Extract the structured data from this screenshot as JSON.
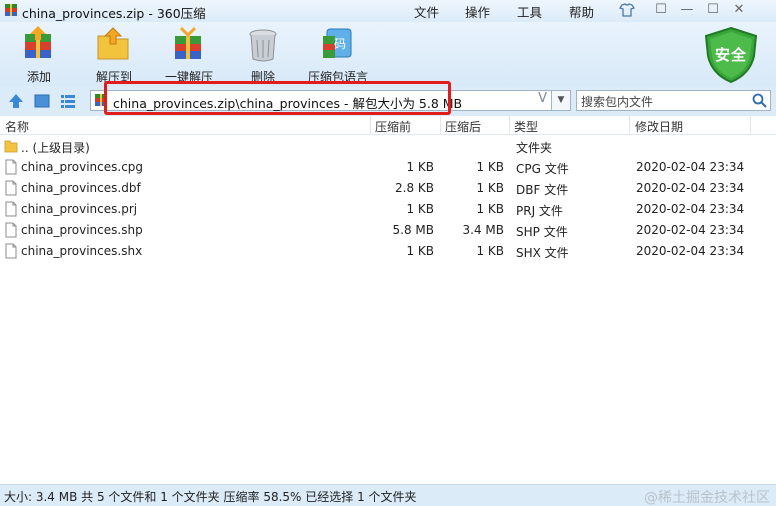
{
  "window": {
    "title": "china_provinces.zip - 360压缩",
    "menu": [
      "文件",
      "操作",
      "工具",
      "帮助"
    ],
    "controls": [
      "☐",
      "—",
      "☐",
      "✕"
    ]
  },
  "toolbar": {
    "buttons": [
      "添加",
      "解压到",
      "一键解压",
      "删除",
      "压缩包语言"
    ],
    "lang_glyph": "码",
    "security_label": "安全"
  },
  "address": {
    "path": "china_provinces.zip\\china_provinces - 解包大小为 5.8 MB",
    "history_glyph": "V",
    "search_placeholder": "搜索包内文件"
  },
  "columns": {
    "name": "名称",
    "packed": "压缩前",
    "compressed": "压缩后",
    "type": "类型",
    "modified": "修改日期"
  },
  "files": [
    {
      "name": ".. (上级目录)",
      "packed": "",
      "compressed": "",
      "type": "文件夹",
      "modified": "",
      "kind": "folder"
    },
    {
      "name": "china_provinces.cpg",
      "packed": "1 KB",
      "compressed": "1 KB",
      "type": "CPG 文件",
      "modified": "2020-02-04 23:34",
      "kind": "file"
    },
    {
      "name": "china_provinces.dbf",
      "packed": "2.8 KB",
      "compressed": "1 KB",
      "type": "DBF 文件",
      "modified": "2020-02-04 23:34",
      "kind": "file"
    },
    {
      "name": "china_provinces.prj",
      "packed": "1 KB",
      "compressed": "1 KB",
      "type": "PRJ 文件",
      "modified": "2020-02-04 23:34",
      "kind": "file"
    },
    {
      "name": "china_provinces.shp",
      "packed": "5.8 MB",
      "compressed": "3.4 MB",
      "type": "SHP 文件",
      "modified": "2020-02-04 23:34",
      "kind": "file"
    },
    {
      "name": "china_provinces.shx",
      "packed": "1 KB",
      "compressed": "1 KB",
      "type": "SHX 文件",
      "modified": "2020-02-04 23:34",
      "kind": "file"
    }
  ],
  "status": {
    "text": "大小: 3.4 MB 共 5 个文件和 1 个文件夹 压缩率 58.5% 已经选择 1 个文件夹",
    "watermark": "@稀土掘金技术社区"
  },
  "colors": {
    "accent_red": "#e21b1b",
    "shield_green": "#3aa53a",
    "chrome_blue": "#dcebf8"
  }
}
